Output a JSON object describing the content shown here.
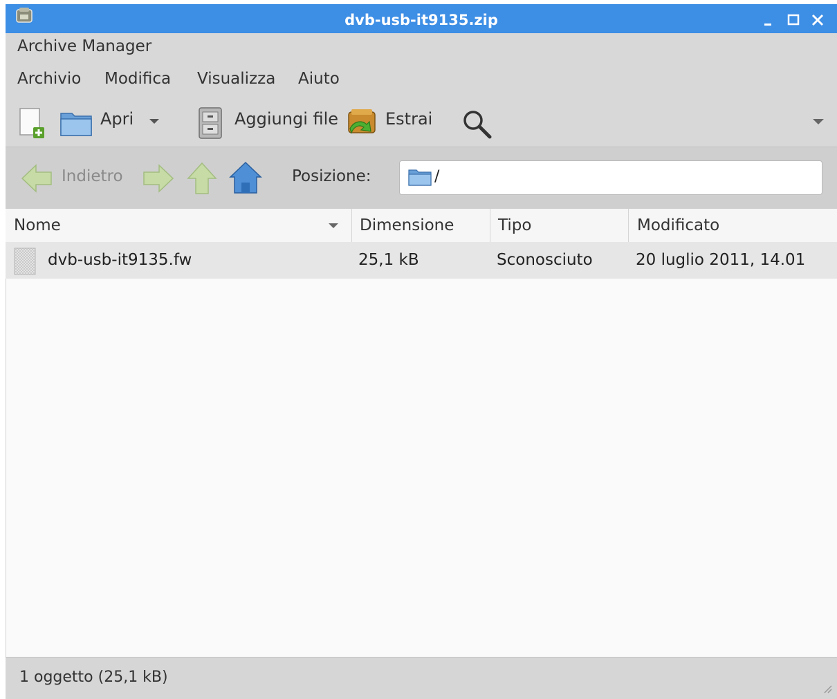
{
  "window": {
    "title": "dvb-usb-it9135.zip"
  },
  "app_label": "Archive Manager",
  "menus": [
    "Archivio",
    "Modifica",
    "Visualizza",
    "Aiuto"
  ],
  "toolbar": {
    "open_label": "Apri",
    "add_files_label": "Aggiungi file",
    "extract_label": "Estrai"
  },
  "navigation": {
    "back_label": "Indietro",
    "location_label": "Posizione:",
    "location_value": "/"
  },
  "columns": [
    "Nome",
    "Dimensione",
    "Tipo",
    "Modificato"
  ],
  "files": [
    {
      "name": "dvb-usb-it9135.fw",
      "size": "25,1 kB",
      "type": "Sconosciuto",
      "modified": "20 luglio 2011, 14.01"
    }
  ],
  "status": "1 oggetto (25,1 kB)",
  "colors": {
    "titlebar": "#3d8ee5",
    "toolbar_bg": "#d8d8d8",
    "selected_row": "#e6e6e6"
  }
}
